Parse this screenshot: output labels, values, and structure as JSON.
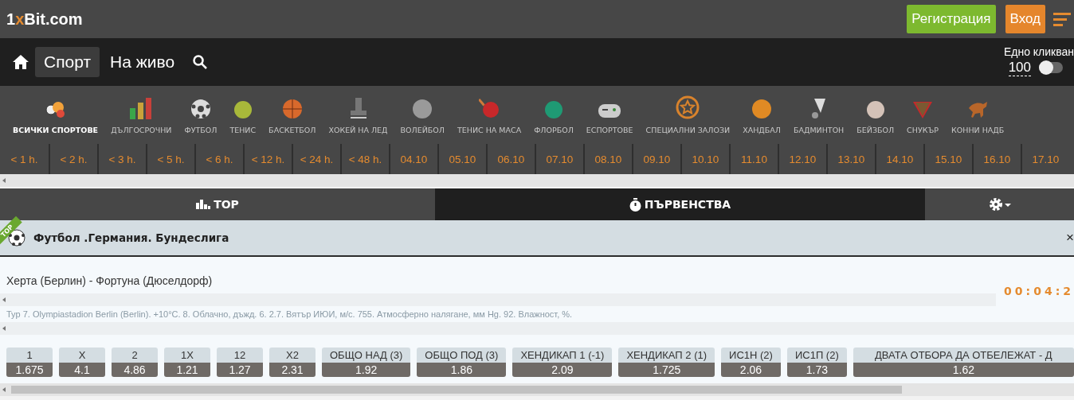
{
  "header": {
    "logo": {
      "lead": "1",
      "mark": "x",
      "rest": "Bit.com"
    },
    "buttons": [
      {
        "label": "Регистрация",
        "kind": "register"
      },
      {
        "label": "Вход",
        "kind": "login"
      }
    ]
  },
  "nav": {
    "items": [
      {
        "label": "Спорт",
        "selected": true
      },
      {
        "label": "На живо",
        "selected": false
      }
    ],
    "one_click": {
      "label": "Едно кликван",
      "amount": "100",
      "on": false
    }
  },
  "sports": [
    {
      "label": "ВСИЧКИ СПОРТОВЕ",
      "selected": true
    },
    {
      "label": "ДЪЛГОСРОЧНИ",
      "selected": false
    },
    {
      "label": "ФУТБОЛ",
      "selected": false
    },
    {
      "label": "ТЕНИС",
      "selected": false
    },
    {
      "label": "БАСКЕТБОЛ",
      "selected": false
    },
    {
      "label": "ХОКЕЙ НА ЛЕД",
      "selected": false
    },
    {
      "label": "ВОЛЕЙБОЛ",
      "selected": false
    },
    {
      "label": "ТЕНИС НА МАСА",
      "selected": false
    },
    {
      "label": "ФЛОРБОЛ",
      "selected": false
    },
    {
      "label": "ЕСПОРТОВЕ",
      "selected": false
    },
    {
      "label": "СПЕЦИАЛНИ ЗАЛОЗИ",
      "selected": false
    },
    {
      "label": "ХАНДБАЛ",
      "selected": false
    },
    {
      "label": "БАДМИНТОН",
      "selected": false
    },
    {
      "label": "БЕЙЗБОЛ",
      "selected": false
    },
    {
      "label": "СНУКЪР",
      "selected": false
    },
    {
      "label": "КОННИ НАДБ",
      "selected": false
    }
  ],
  "time_filters": [
    "< 1 h.",
    "< 2 h.",
    "< 3 h.",
    "< 5 h.",
    "< 6 h.",
    "< 12 h.",
    "< 24 h.",
    "< 48 h.",
    "04.10",
    "05.10",
    "06.10",
    "07.10",
    "08.10",
    "09.10",
    "10.10",
    "11.10",
    "12.10",
    "13.10",
    "14.10",
    "15.10",
    "16.10",
    "17.10"
  ],
  "tabs": [
    {
      "label": "TOP",
      "selected": false
    },
    {
      "label": "ПЪРВЕНСТВА",
      "selected": true
    }
  ],
  "league": {
    "ribbon": "TOP",
    "title": "Футбол .Германия. Бундеслига",
    "close": "×"
  },
  "match": {
    "teams": "Херта (Берлин) - Фортуна (Дюселдорф)",
    "timer": "00:04:2",
    "info": "Тур 7. Olympiastadion Berlin (Berlin). +10°C. 8. Облачно, дъжд. 6. 2.7. Вятър ИЮИ, м/с. 755. Атмосферно налягане, мм Hg. 92. Влажност, %."
  },
  "odds": [
    {
      "label": "1",
      "value": "1.675"
    },
    {
      "label": "X",
      "value": "4.1"
    },
    {
      "label": "2",
      "value": "4.86"
    },
    {
      "label": "1X",
      "value": "1.21"
    },
    {
      "label": "12",
      "value": "1.27"
    },
    {
      "label": "X2",
      "value": "2.31"
    },
    {
      "label": "ОБЩО НАД (3)",
      "value": "1.92"
    },
    {
      "label": "ОБЩО ПОД (3)",
      "value": "1.86"
    },
    {
      "label": "ХЕНДИКАП 1 (-1)",
      "value": "2.09"
    },
    {
      "label": "ХЕНДИКАП 2 (1)",
      "value": "1.725"
    },
    {
      "label": "ИС1Н (2)",
      "value": "2.06"
    },
    {
      "label": "ИС1П (2)",
      "value": "1.73"
    },
    {
      "label": "ДВАТА ОТБОРА ДА ОТБЕЛЕЖАТ - Д",
      "value": "1.62"
    }
  ]
}
